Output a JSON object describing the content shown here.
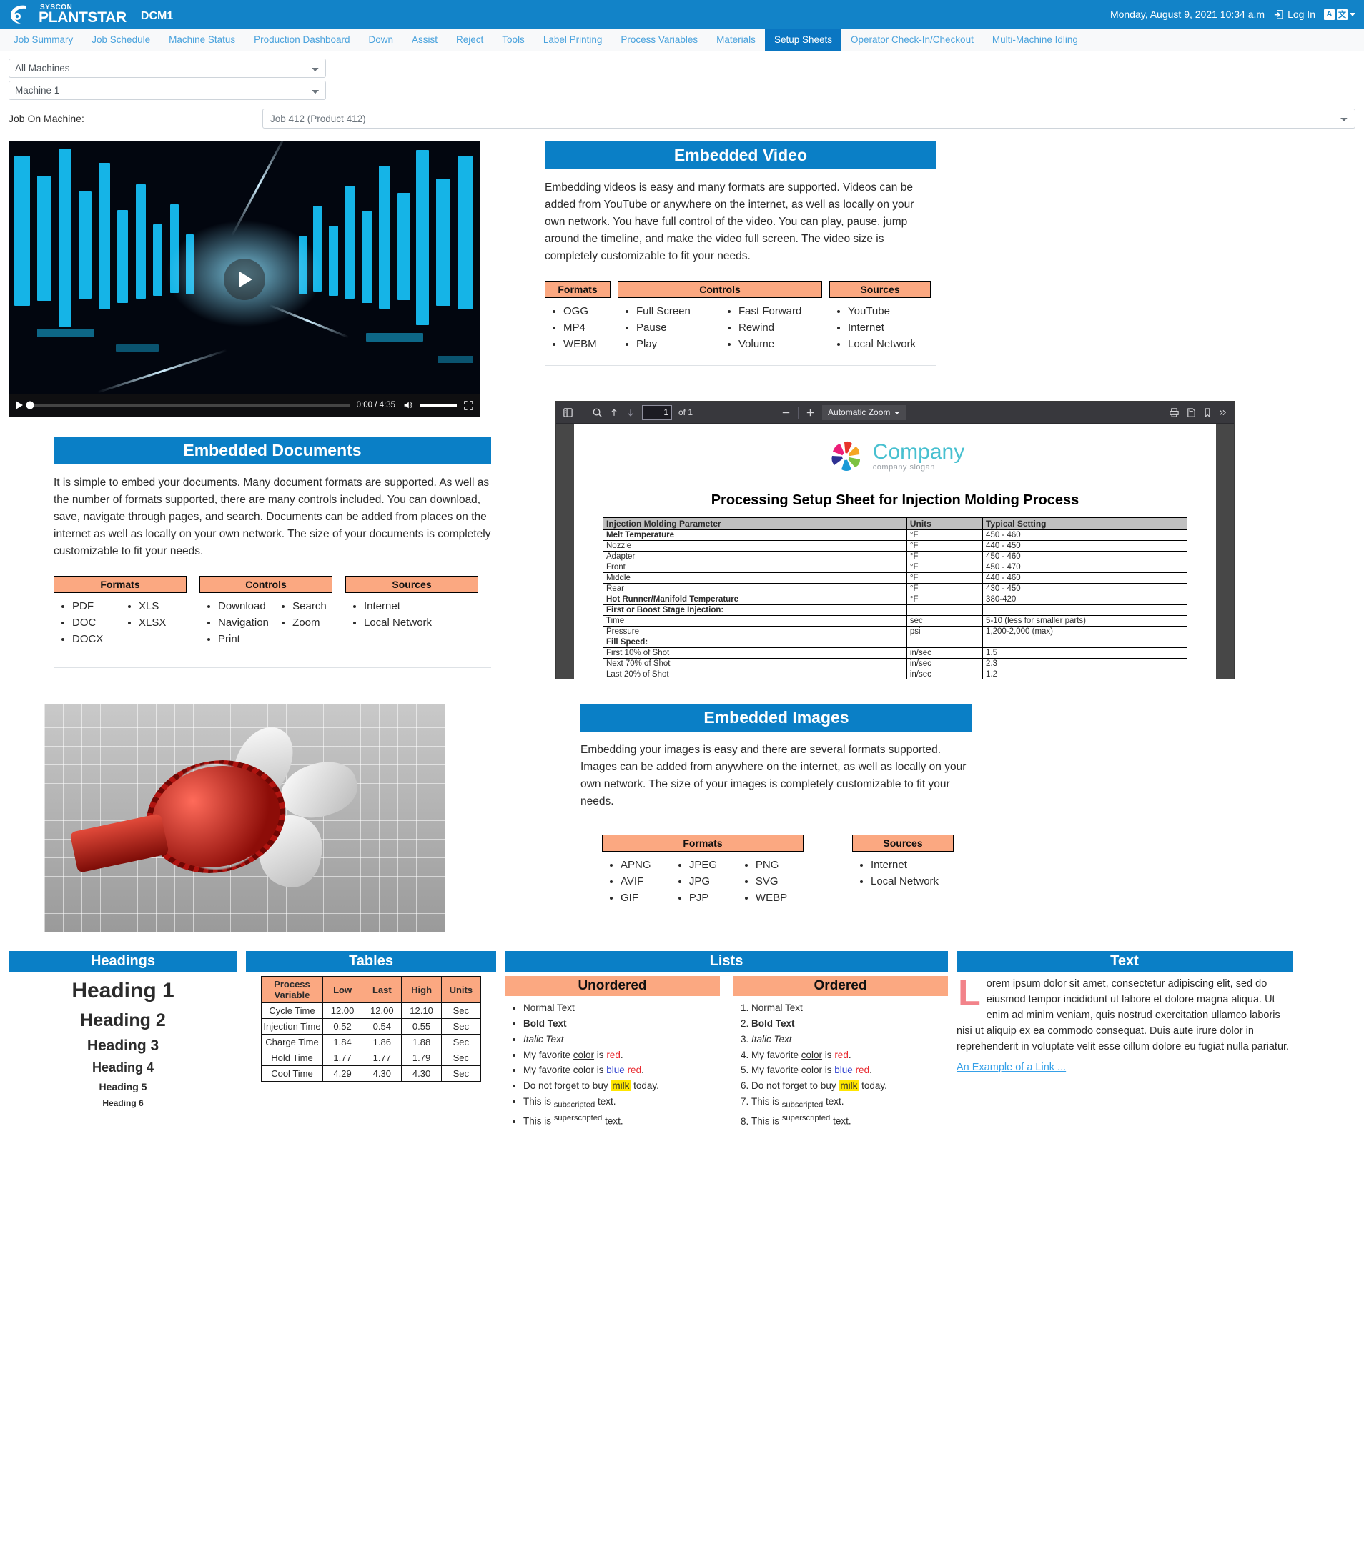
{
  "header": {
    "brand_syscon": "SYSCON",
    "brand_plantstar": "PLANTSTAR",
    "unit": "DCM1",
    "datetime": "Monday, August 9, 2021 10:34 a.m",
    "login": "Log In",
    "lang_a": "A",
    "lang_b": "文"
  },
  "nav": {
    "items": [
      {
        "label": "Job Summary",
        "active": false
      },
      {
        "label": "Job Schedule",
        "active": false
      },
      {
        "label": "Machine Status",
        "active": false
      },
      {
        "label": "Production Dashboard",
        "active": false
      },
      {
        "label": "Down",
        "active": false
      },
      {
        "label": "Assist",
        "active": false
      },
      {
        "label": "Reject",
        "active": false
      },
      {
        "label": "Tools",
        "active": false
      },
      {
        "label": "Label Printing",
        "active": false
      },
      {
        "label": "Process Variables",
        "active": false
      },
      {
        "label": "Materials",
        "active": false
      },
      {
        "label": "Setup Sheets",
        "active": true
      },
      {
        "label": "Operator Check-In/Checkout",
        "active": false
      },
      {
        "label": "Multi-Machine Idling",
        "active": false
      }
    ]
  },
  "selectors": {
    "all_machines": "All Machines",
    "machine": "Machine 1",
    "job_label": "Job On Machine:",
    "job_value": "Job 412 (Product 412)"
  },
  "video_player": {
    "current_time": "0:00",
    "duration": "4:35",
    "time_display": "0:00 / 4:35",
    "play_icon": "play-icon",
    "volume_icon": "volume-icon",
    "fullscreen_icon": "fullscreen-icon"
  },
  "embedded_video": {
    "title": "Embedded Video",
    "body": "Embedding videos is easy and many formats are supported. Videos can be added from YouTube or anywhere on the internet, as well as locally on your own network. You have full control of the video. You can play, pause, jump around the timeline, and make the video full screen. The video size is completely customizable to fit your needs.",
    "formats_head": "Formats",
    "formats": [
      "OGG",
      "MP4",
      "WEBM"
    ],
    "controls_head": "Controls",
    "controls_a": [
      "Full Screen",
      "Pause",
      "Play"
    ],
    "controls_b": [
      "Fast Forward",
      "Rewind",
      "Volume"
    ],
    "sources_head": "Sources",
    "sources": [
      "YouTube",
      "Internet",
      "Local Network"
    ]
  },
  "embedded_documents": {
    "title": "Embedded Documents",
    "body": "It is simple to embed your documents. Many document formats are supported. As well as the number of formats supported, there are many controls included. You can download, save, navigate through pages, and search. Documents can be added from places on the internet as well as locally on your own network. The size of your documents is completely customizable to fit your needs.",
    "formats_head": "Formats",
    "formats_a": [
      "PDF",
      "DOC",
      "DOCX"
    ],
    "formats_b": [
      "XLS",
      "XLSX"
    ],
    "controls_head": "Controls",
    "controls_a": [
      "Download",
      "Navigation",
      "Print"
    ],
    "controls_b": [
      "Search",
      "Zoom"
    ],
    "sources_head": "Sources",
    "sources": [
      "Internet",
      "Local Network"
    ]
  },
  "pdf_viewer": {
    "page_value": "1",
    "of_label": "of 1",
    "zoom_value": "Automatic Zoom",
    "sidebar_icon": "sidebar-toggle-icon",
    "find_icon": "search-icon",
    "prev_icon": "arrow-up-icon",
    "next_icon": "arrow-down-icon",
    "zoom_out_icon": "minus-icon",
    "zoom_in_icon": "plus-icon",
    "print_icon": "print-icon",
    "save_icon": "save-icon",
    "bookmark_icon": "bookmark-icon",
    "more_icon": "double-chevron-right-icon",
    "document": {
      "company": "Company",
      "slogan": "company slogan",
      "title": "Processing Setup Sheet for Injection Molding Process",
      "columns": [
        "Injection Molding Parameter",
        "Units",
        "Typical Setting"
      ],
      "rows": [
        {
          "param": "Melt Temperature",
          "units": "°F",
          "setting": "450 - 460",
          "bold": true,
          "indent": false
        },
        {
          "param": "Nozzle",
          "units": "°F",
          "setting": "440 - 450",
          "bold": false,
          "indent": true
        },
        {
          "param": "Adapter",
          "units": "°F",
          "setting": "450 - 460",
          "bold": false,
          "indent": true
        },
        {
          "param": "Front",
          "units": "°F",
          "setting": "450 - 470",
          "bold": false,
          "indent": true
        },
        {
          "param": "Middle",
          "units": "°F",
          "setting": "440 - 460",
          "bold": false,
          "indent": true
        },
        {
          "param": "Rear",
          "units": "°F",
          "setting": "430 - 450",
          "bold": false,
          "indent": true
        },
        {
          "param": "Hot Runner/Manifold Temperature",
          "units": "°F",
          "setting": "380-420",
          "bold": true,
          "indent": false
        },
        {
          "param": "First or Boost Stage Injection:",
          "units": "",
          "setting": "",
          "bold": true,
          "indent": false
        },
        {
          "param": "Time",
          "units": "sec",
          "setting": "5-10 (less for smaller parts)",
          "bold": false,
          "indent": true
        },
        {
          "param": "Pressure",
          "units": "psi",
          "setting": "1,200-2,000 (max)",
          "bold": false,
          "indent": true
        },
        {
          "param": "Fill Speed:",
          "units": "",
          "setting": "",
          "bold": true,
          "indent": false
        },
        {
          "param": "First 10% of Shot",
          "units": "in/sec",
          "setting": "1.5",
          "bold": false,
          "indent": true
        },
        {
          "param": "Next 70% of Shot",
          "units": "in/sec",
          "setting": "2.3",
          "bold": false,
          "indent": true
        },
        {
          "param": "Last 20% of Shot",
          "units": "in/sec",
          "setting": "1.2",
          "bold": false,
          "indent": true
        }
      ]
    }
  },
  "embedded_images": {
    "title": "Embedded Images",
    "body": "Embedding your images is easy and there are several formats supported. Images can be added from anywhere on the internet, as well as locally on your own network. The size of your images is completely customizable to fit your needs.",
    "formats_head": "Formats",
    "formats_a": [
      "APNG",
      "AVIF",
      "GIF"
    ],
    "formats_b": [
      "JPEG",
      "JPG",
      "PJP"
    ],
    "formats_c": [
      "PNG",
      "SVG",
      "WEBP"
    ],
    "sources_head": "Sources",
    "sources": [
      "Internet",
      "Local Network"
    ]
  },
  "headings_panel": {
    "title": "Headings",
    "h1": "Heading 1",
    "h2": "Heading 2",
    "h3": "Heading 3",
    "h4": "Heading 4",
    "h5": "Heading 5",
    "h6": "Heading 6"
  },
  "tables_panel": {
    "title": "Tables",
    "columns": [
      "Process Variable",
      "Low",
      "Last",
      "High",
      "Units"
    ],
    "rows": [
      {
        "variable": "Cycle Time",
        "low": "12.00",
        "last": "12.00",
        "high": "12.10",
        "units": "Sec"
      },
      {
        "variable": "Injection Time",
        "low": "0.52",
        "last": "0.54",
        "high": "0.55",
        "units": "Sec"
      },
      {
        "variable": "Charge Time",
        "low": "1.84",
        "last": "1.86",
        "high": "1.88",
        "units": "Sec"
      },
      {
        "variable": "Hold Time",
        "low": "1.77",
        "last": "1.77",
        "high": "1.79",
        "units": "Sec"
      },
      {
        "variable": "Cool Time",
        "low": "4.29",
        "last": "4.30",
        "high": "4.30",
        "units": "Sec"
      }
    ]
  },
  "lists_panel": {
    "title": "Lists",
    "unordered_head": "Unordered",
    "ordered_head": "Ordered",
    "items": {
      "normal": "Normal Text",
      "bold": "Bold Text",
      "italic": "Italic Text",
      "color_pre": "My favorite ",
      "color_word": "color",
      "color_mid": " is ",
      "color_red": "red",
      "color_end": ".",
      "strike_pre": "My favorite color is ",
      "strike_blue": "blue",
      "strike_red": " red",
      "strike_end": ".",
      "milk_pre": "Do not forget to buy ",
      "milk_word": "milk",
      "milk_post": " today.",
      "sub_pre": "This is ",
      "sub_word": "subscripted",
      "sub_post": " text.",
      "sup_pre": "This is ",
      "sup_word": "superscripted",
      "sup_post": " text."
    }
  },
  "text_panel": {
    "title": "Text",
    "dropcap": "L",
    "body": "orem ipsum dolor sit amet, consectetur adipiscing elit, sed do eiusmod tempor incididunt ut labore et dolore magna aliqua. Ut enim ad minim veniam, quis nostrud exercitation ullamco laboris nisi ut aliquip ex ea commodo consequat. Duis aute irure dolor in reprehenderit in voluptate velit esse cillum dolore eu fugiat nulla pariatur.",
    "link": "An Example of a Link ..."
  },
  "colors": {
    "brand_blue": "#1283c8",
    "header_blue": "#0a7fc6",
    "accent_peach": "#fba881",
    "link_blue": "#35a0e8",
    "highlight_yellow": "#ffe600",
    "red": "#e8262c"
  }
}
